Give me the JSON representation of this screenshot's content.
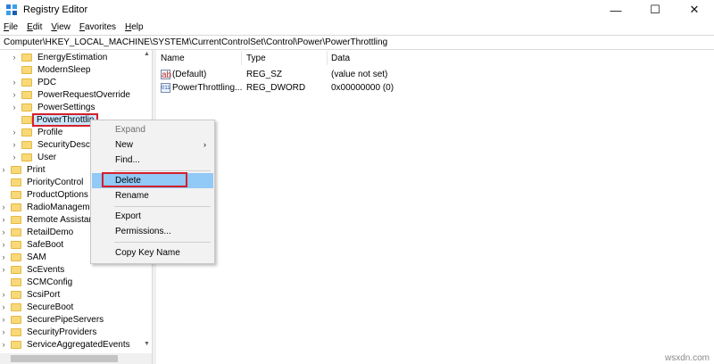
{
  "window": {
    "title": "Registry Editor",
    "minimize_glyph": "—",
    "maximize_glyph": "☐",
    "close_glyph": "✕"
  },
  "menu": [
    {
      "label": "File",
      "accel": "F",
      "rest": "ile"
    },
    {
      "label": "Edit",
      "accel": "E",
      "rest": "dit"
    },
    {
      "label": "View",
      "accel": "V",
      "rest": "iew"
    },
    {
      "label": "Favorites",
      "accel": "F",
      "rest": "avorites"
    },
    {
      "label": "Help",
      "accel": "H",
      "rest": "elp"
    }
  ],
  "address": "Computer\\HKEY_LOCAL_MACHINE\\SYSTEM\\CurrentControlSet\\Control\\Power\\PowerThrottling",
  "tree": {
    "items": [
      {
        "label": "EnergyEstimation",
        "expander": "›"
      },
      {
        "label": "ModernSleep",
        "expander": ""
      },
      {
        "label": "PDC",
        "expander": "›"
      },
      {
        "label": "PowerRequestOverride",
        "expander": "›"
      },
      {
        "label": "PowerSettings",
        "expander": "›"
      },
      {
        "label": "PowerThrottlin",
        "expander": "",
        "selected": true
      },
      {
        "label": "Profile",
        "expander": "›"
      },
      {
        "label": "SecurityDescrip",
        "expander": "›"
      },
      {
        "label": "User",
        "expander": "›"
      },
      {
        "label": "Print",
        "expander": "›"
      },
      {
        "label": "PriorityControl",
        "expander": ""
      },
      {
        "label": "ProductOptions",
        "expander": ""
      },
      {
        "label": "RadioManagemer",
        "expander": "›"
      },
      {
        "label": "Remote Assistanc",
        "expander": "›"
      },
      {
        "label": "RetailDemo",
        "expander": "›"
      },
      {
        "label": "SafeBoot",
        "expander": "›"
      },
      {
        "label": "SAM",
        "expander": "›"
      },
      {
        "label": "ScEvents",
        "expander": "›"
      },
      {
        "label": "SCMConfig",
        "expander": ""
      },
      {
        "label": "ScsiPort",
        "expander": "›"
      },
      {
        "label": "SecureBoot",
        "expander": "›"
      },
      {
        "label": "SecurePipeServers",
        "expander": "›"
      },
      {
        "label": "SecurityProviders",
        "expander": "›"
      },
      {
        "label": "ServiceAggregatedEvents",
        "expander": "›"
      }
    ]
  },
  "list": {
    "headers": {
      "name": "Name",
      "type": "Type",
      "data": "Data"
    },
    "rows": [
      {
        "icon": "ab",
        "name": "(Default)",
        "type": "REG_SZ",
        "data": "(value not set)"
      },
      {
        "icon": "011",
        "name": "PowerThrottling...",
        "type": "REG_DWORD",
        "data": "0x00000000 (0)"
      }
    ]
  },
  "context_menu": {
    "expand": "Expand",
    "new": "New",
    "find": "Find...",
    "delete": "Delete",
    "rename": "Rename",
    "export": "Export",
    "permissions": "Permissions...",
    "copy_key_name": "Copy Key Name",
    "submenu_arrow": "›"
  },
  "watermark": "wsxdn.com",
  "colors": {
    "highlight_red": "#d5202a",
    "menu_hover": "#91c9f7",
    "folder": "#f7d97a"
  }
}
